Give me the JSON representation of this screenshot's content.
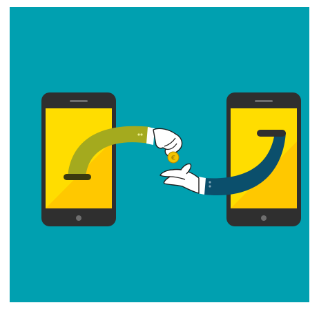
{
  "illustration": {
    "colors": {
      "page_background": "#ffffff",
      "teal_background": "#00A0B0",
      "phone_body": "#2F2F2F",
      "phone_speaker": "#6E6E6E",
      "phone_button": "#6E6E6E",
      "screen_yellow": "#FFDD00",
      "screen_shade": "#FFC800",
      "left_sleeve_green": "#A4AA1E",
      "left_sleeve_stripe": "#C4CC45",
      "right_sleeve_navy": "#0B4F6C",
      "right_sleeve_stripe": "#7FA4B6",
      "hand_white": "#FFFFFF",
      "hand_outline": "#1E1E1E",
      "coin_gold": "#F2C400",
      "coin_mark": "#B08A00",
      "slot_dark": "#3A3A0F"
    },
    "elements": {
      "left_phone": "smartphone-left",
      "right_phone": "smartphone-right",
      "giving_hand": "hand-holding-coin-icon",
      "receiving_hand": "open-hand-icon",
      "coin": "coin-icon"
    }
  }
}
